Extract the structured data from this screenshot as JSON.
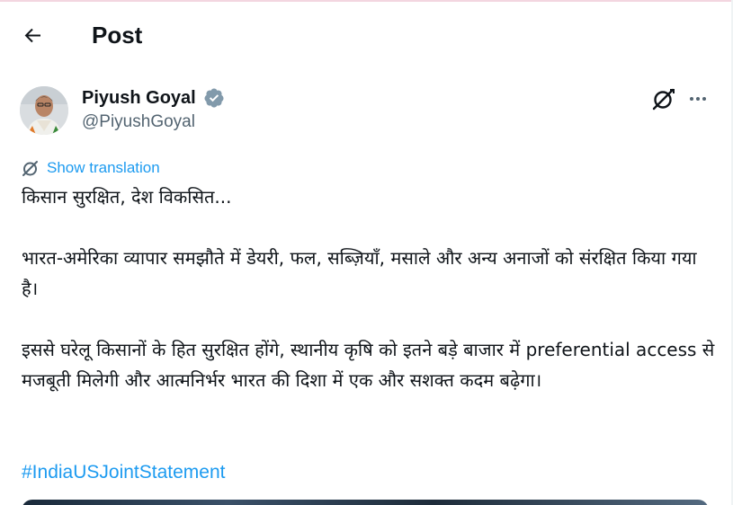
{
  "header": {
    "title": "Post"
  },
  "author": {
    "name": "Piyush Goyal",
    "handle": "@PiyushGoyal",
    "verified": true,
    "verified_color": "#829aab"
  },
  "icons": {
    "back": "arrow-left-icon",
    "verified": "verified-badge-icon",
    "grok": "grok-icon",
    "more": "more-options-icon",
    "translate": "translate-icon"
  },
  "translation": {
    "label": "Show translation"
  },
  "post": {
    "paragraphs": [
      "किसान सुरक्षित, देश विकसित...",
      "भारत-अमेरिका व्यापार समझौते में डेयरी, फल, सब्ज़ियाँ, मसाले और अन्य अनाजों को संरक्षित किया गया है।",
      "इससे घरेलू किसानों के हित सुरक्षित होंगे, स्थानीय कृषि को इतने बड़े बाजार में preferential access से मजबूती मिलेगी और आत्मनिर्भर भारत की दिशा में एक और सशक्त कदम बढ़ेगा।"
    ],
    "hashtag": "#IndiaUSJointStatement"
  },
  "colors": {
    "text": "#0f1419",
    "secondary": "#536471",
    "accent": "#1d9bf0"
  }
}
